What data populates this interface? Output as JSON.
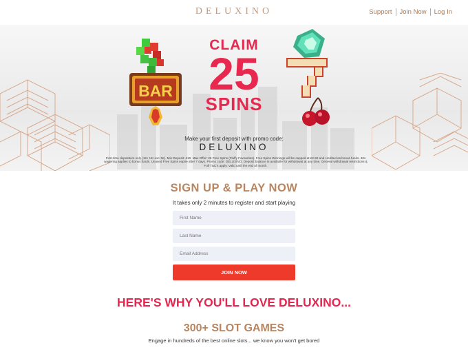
{
  "header": {
    "logo": "DELUXINO",
    "nav": [
      "Support",
      "Join Now",
      "Log In"
    ]
  },
  "hero": {
    "claim": "CLAIM",
    "amount": "25",
    "spins": "SPINS",
    "promo_label": "Make your first deposit with promo code:",
    "promo_code": "DELUXINO",
    "terms": "First-time depositors only (18+ UK excl NI). Min Deposit: £10. Max Offer: 25 Free Spins (Fluffy Favourites). Free Spins Winnings will be capped at £2.50 and credited as bonus funds. 40x wagering applies to bonus funds. Unused Free Spins expire after 7 days. Promo code: DELUXINO. Deposit balance is available for withdrawal at any time. General withdrawal restrictions & Full T&C's apply. Valid until the end of month.",
    "symbol_bar": "BAR"
  },
  "signup": {
    "title": "SIGN UP & PLAY NOW",
    "subtitle": "It takes only 2 minutes to register and start playing",
    "first_name_placeholder": "First Name",
    "last_name_placeholder": "Last Name",
    "email_placeholder": "Email Address",
    "button": "JOIN NOW"
  },
  "features": {
    "heading": "HERE'S WHY YOU'LL LOVE DELUXINO...",
    "slots_title": "300+ SLOT GAMES",
    "slots_text": "Engage in hundreds of the best online slots... we know you won't get bored"
  },
  "colors": {
    "accent_red": "#e8284f",
    "gold": "#b88560",
    "button": "#ee3a2a"
  }
}
